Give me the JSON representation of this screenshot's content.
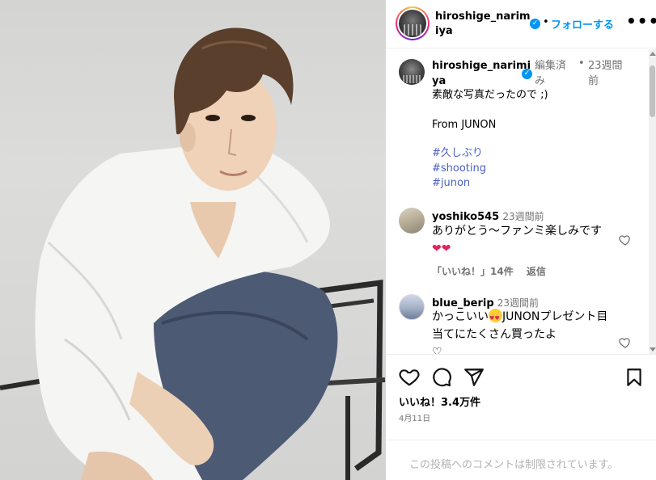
{
  "post": {
    "username": "hiroshige_narimiya",
    "follow_label": "フォローする",
    "dot": "•",
    "more_label": "•••"
  },
  "caption": {
    "username": "hiroshige_narimiya",
    "edited_label": "編集済み",
    "dot": "•",
    "time": "23週間前",
    "text": "素敵な写真だったので ;)",
    "from": "From JUNON",
    "hashtags": [
      "#久しぶり",
      "#shooting",
      "#junon"
    ]
  },
  "comments": [
    {
      "username": "yoshiko545",
      "time": "23週間前",
      "text": "ありがとう〜ファンミ楽しみです",
      "emoji": "❤❤",
      "likes_label": "「いいね！」14件",
      "reply_label": "返信"
    },
    {
      "username": "blue_berip",
      "time": "23週間前",
      "text_prefix": "かっこいい",
      "text": "JUNONプレゼント目当てにたくさん買ったよ",
      "emoji_suffix": "♡"
    }
  ],
  "actions": {
    "likes": "いいね！3.4万件",
    "date": "4月11日"
  },
  "restricted": "この投稿へのコメントは制限されています。",
  "icons": {
    "verified": "verified-badge-icon",
    "like": "heart-outline-icon",
    "comment": "speech-bubble-icon",
    "share": "paper-plane-icon",
    "save": "bookmark-icon",
    "more": "ellipsis-icon"
  },
  "colors": {
    "accent": "#0095f6",
    "hashtag": "#4a60c8",
    "muted": "#737373"
  }
}
